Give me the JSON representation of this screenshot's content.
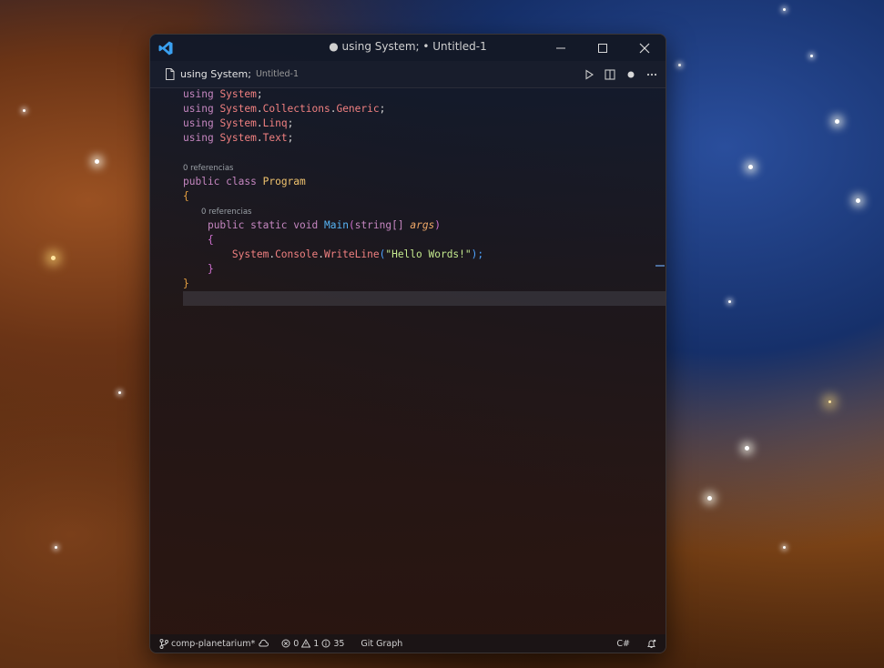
{
  "window": {
    "title": "● using System; • Untitled-1",
    "app_icon": "vscode-logo"
  },
  "tab": {
    "label": "using System;",
    "description": "Untitled-1",
    "icon": "file-icon",
    "actions": [
      "run-icon",
      "split-editor-icon",
      "dirty-dot-icon",
      "more-icon"
    ]
  },
  "code": {
    "line1": {
      "kw": "using",
      "ns": "System",
      "end": ";"
    },
    "line2": {
      "kw": "using",
      "ns1": "System",
      "dot1": ".",
      "ns2": "Collections",
      "dot2": ".",
      "ns3": "Generic",
      "end": ";"
    },
    "line3": {
      "kw": "using",
      "ns1": "System",
      "dot1": ".",
      "ns2": "Linq",
      "end": ";"
    },
    "line4": {
      "kw": "using",
      "ns1": "System",
      "dot1": ".",
      "ns2": "Text",
      "end": ";"
    },
    "lens_class": "0 referencias",
    "class_kw1": "public",
    "class_kw2": "class",
    "class_name": "Program",
    "brace_open": "{",
    "lens_method": "0 referencias",
    "method_kw1": "public",
    "method_kw2": "static",
    "method_kw3": "void",
    "method_name": "Main",
    "method_paren_open": "(",
    "method_type": "string[]",
    "method_param": "args",
    "method_paren_close": ")",
    "inner_open": "{",
    "call_ns": "System",
    "call_dot1": ".",
    "call_cls": "Console",
    "call_dot2": ".",
    "call_fn": "WriteLine",
    "call_paren_open": "(",
    "call_str": "\"Hello Words!\"",
    "call_close": ");",
    "inner_close": "}",
    "brace_close": "}"
  },
  "status": {
    "branch": "comp-planetarium*",
    "errors": "0",
    "warnings": "1",
    "info": "35",
    "git_graph": "Git Graph",
    "language": "C#"
  },
  "colors": {
    "keyword": "#c586c0",
    "namespace": "#f08080",
    "class": "#f0c36e",
    "function": "#57b5f6",
    "string": "#c3e88d"
  }
}
